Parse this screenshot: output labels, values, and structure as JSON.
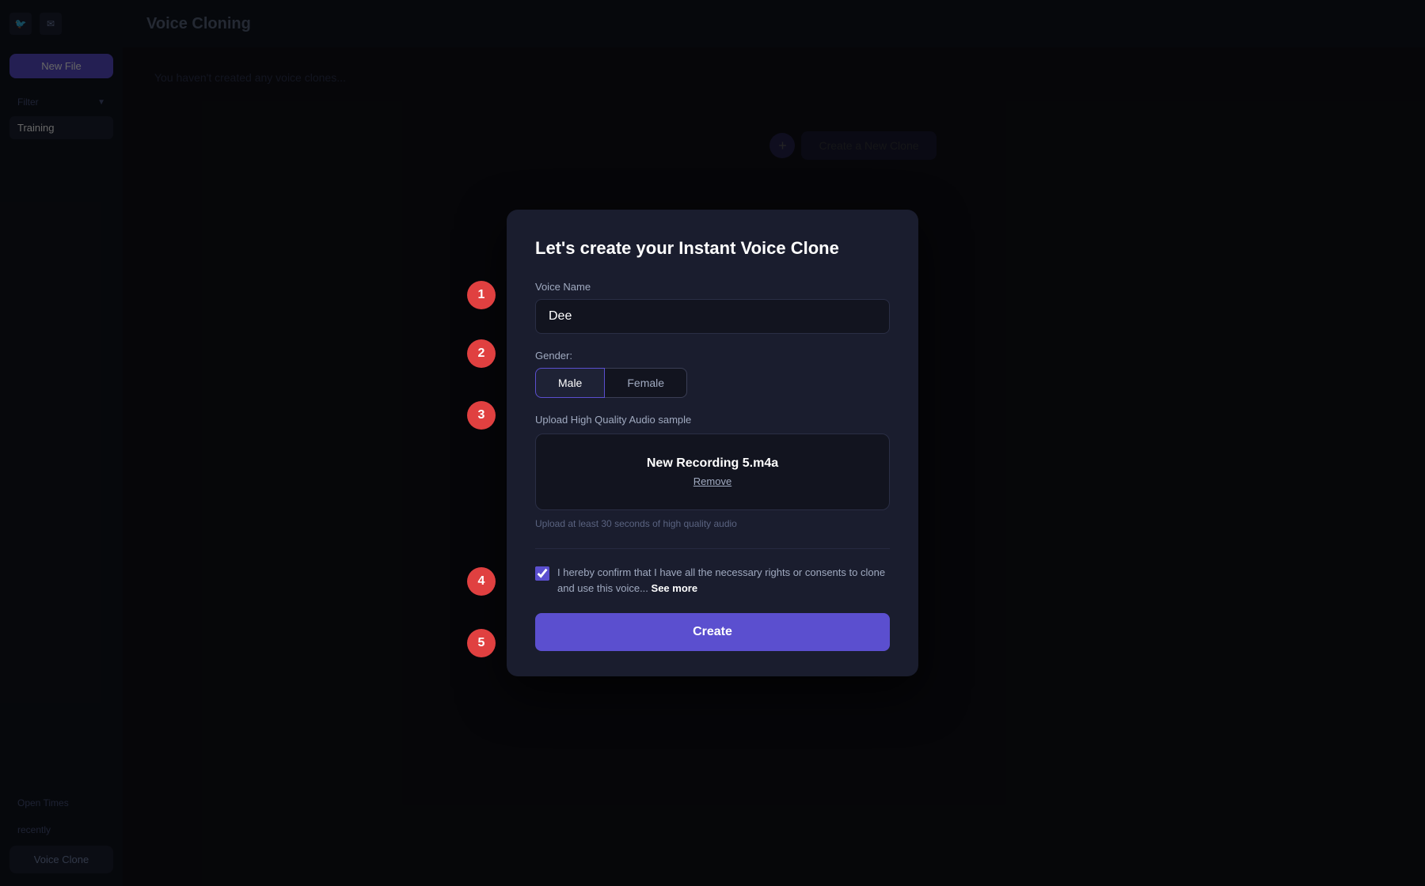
{
  "app": {
    "title": "Voice Cloning"
  },
  "sidebar": {
    "new_file_label": "New File",
    "filter_placeholder": "Filter...",
    "sections": [
      {
        "id": "training",
        "label": "Training"
      },
      {
        "id": "empty1",
        "label": ""
      },
      {
        "id": "empty2",
        "label": ""
      }
    ],
    "bottom_items": [
      {
        "id": "open-times",
        "label": "Open Times"
      },
      {
        "id": "recently",
        "label": "recently"
      },
      {
        "id": "voice-clone",
        "label": "Voice Clone"
      }
    ]
  },
  "background": {
    "page_title": "Voice Cloning",
    "empty_text": "You haven't created any voice clones...",
    "create_clone_label": "Create a New Clone"
  },
  "modal": {
    "title": "Let's create your Instant Voice Clone",
    "voice_name_label": "Voice Name",
    "voice_name_value": "Dee",
    "voice_name_placeholder": "Dee",
    "gender_label": "Gender:",
    "gender_options": [
      {
        "id": "male",
        "label": "Male",
        "selected": true
      },
      {
        "id": "female",
        "label": "Female",
        "selected": false
      }
    ],
    "audio_section_label": "Upload High Quality Audio sample",
    "audio_filename": "New Recording 5.m4a",
    "remove_label": "Remove",
    "audio_hint": "Upload at least 30 seconds of high quality audio",
    "consent_text": "I hereby confirm that I have all the necessary rights or consents to clone and use this voice...",
    "consent_see_more": "See more",
    "consent_checked": true,
    "create_button_label": "Create"
  },
  "steps": [
    {
      "id": "step-1",
      "number": "1"
    },
    {
      "id": "step-2",
      "number": "2"
    },
    {
      "id": "step-3",
      "number": "3"
    },
    {
      "id": "step-4",
      "number": "4"
    },
    {
      "id": "step-5",
      "number": "5"
    }
  ],
  "icons": {
    "twitter": "🐦",
    "mail": "✉",
    "plus": "+"
  }
}
